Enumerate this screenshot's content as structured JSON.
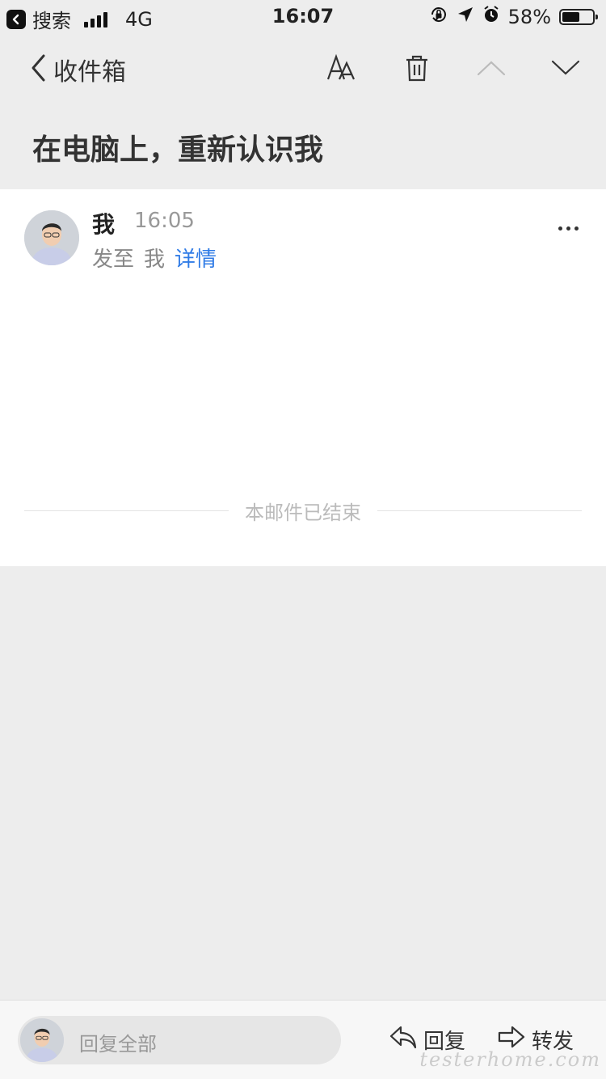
{
  "status_bar": {
    "back_app": "搜索",
    "network": "4G",
    "time": "16:07",
    "battery": "58%",
    "battery_level": 0.58,
    "signal_icon": "signal-icon",
    "orientation_lock_icon": "orientation-lock-icon",
    "location_icon": "location-arrow-icon",
    "alarm_icon": "alarm-icon"
  },
  "nav": {
    "back_label": "收件箱",
    "icons": [
      "font-size-icon",
      "trash-icon",
      "chevron-up-icon",
      "chevron-down-icon"
    ]
  },
  "mail": {
    "subject": "在电脑上，重新认识我",
    "sender": "我",
    "time": "16:05",
    "sent_to_prefix": "发至",
    "recipient": "我",
    "details_link": "详情",
    "end_text": "本邮件已结束"
  },
  "bottom_bar": {
    "reply_all_placeholder": "回复全部",
    "reply_label": "回复",
    "forward_label": "转发"
  },
  "watermark": "testerhome.com",
  "colors": {
    "background": "#ededed",
    "card": "#ffffff",
    "link": "#2f7be6",
    "muted": "#999999"
  }
}
